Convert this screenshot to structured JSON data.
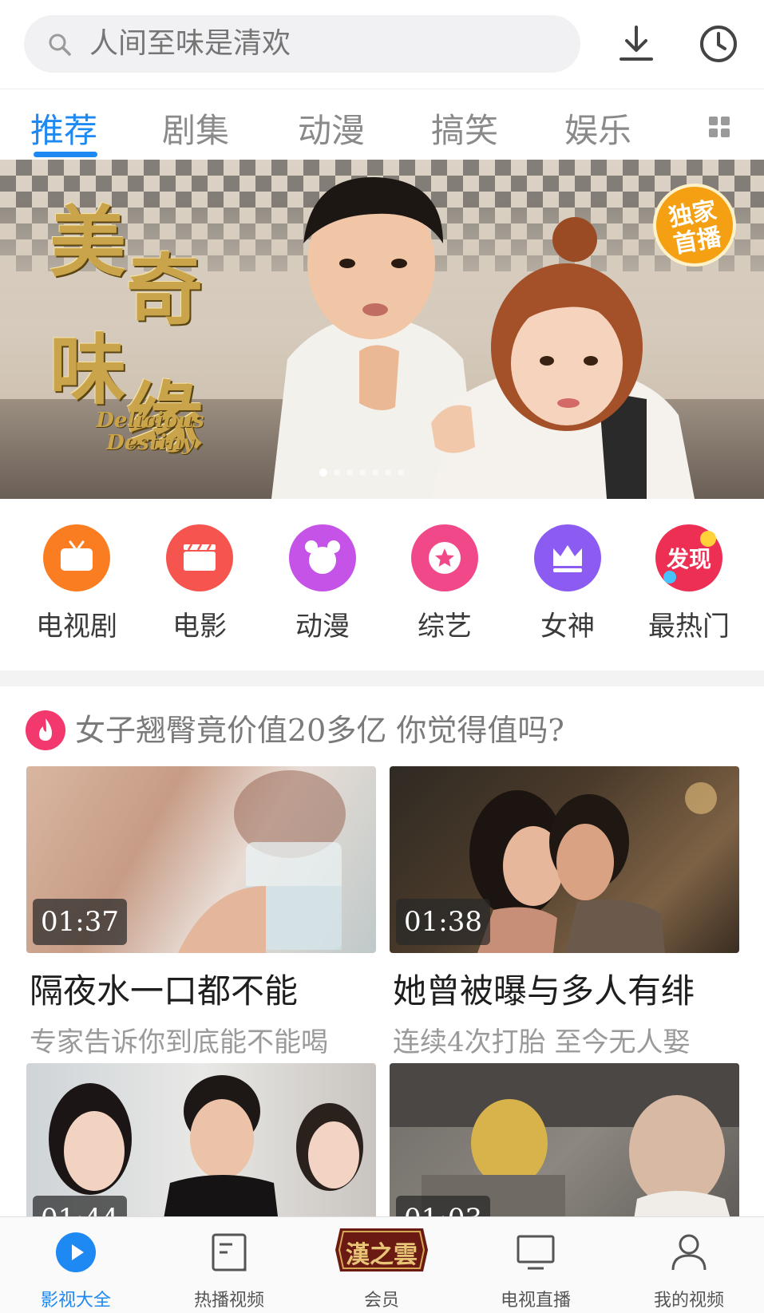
{
  "search": {
    "placeholder": "人间至味是清欢"
  },
  "tabs": [
    {
      "label": "推荐"
    },
    {
      "label": "剧集"
    },
    {
      "label": "动漫"
    },
    {
      "label": "搞笑"
    },
    {
      "label": "娱乐"
    }
  ],
  "banner": {
    "title_chars": [
      "美",
      "奇",
      "味",
      "缘"
    ],
    "subtitle_line1": "Delicious",
    "subtitle_line2": "Destiny",
    "badge_line1": "独家",
    "badge_line2": "首播",
    "slide_count": 7,
    "active_slide": 0
  },
  "categories": [
    {
      "label": "电视剧",
      "color": "#fb7d22"
    },
    {
      "label": "电影",
      "color": "#f6554f"
    },
    {
      "label": "动漫",
      "color": "#c653e8"
    },
    {
      "label": "综艺",
      "color": "#f1488a"
    },
    {
      "label": "女神",
      "color": "#8c5cf2"
    },
    {
      "label": "最热门",
      "icon_text": "发现",
      "color": "#ee2f54"
    }
  ],
  "topic": {
    "text": "女子翘臀竟价值20多亿 你觉得值吗?"
  },
  "videos": [
    {
      "duration": "01:37",
      "title": "隔夜水一口都不能",
      "subtitle": "专家告诉你到底能不能喝"
    },
    {
      "duration": "01:38",
      "title": "她曾被曝与多人有绯",
      "subtitle": "连续4次打胎 至今无人娶"
    },
    {
      "duration": "01:44",
      "title": "",
      "subtitle": ""
    },
    {
      "duration": "01:03",
      "title": "",
      "subtitle": ""
    }
  ],
  "bottom_nav": [
    {
      "label": "影视大全",
      "icon": "play-circle-icon",
      "active": true
    },
    {
      "label": "热播视频",
      "icon": "document-icon"
    },
    {
      "label": "会员",
      "icon": "vip-logo-icon",
      "logo_text": "漢之雲"
    },
    {
      "label": "电视直播",
      "icon": "tv-icon"
    },
    {
      "label": "我的视频",
      "icon": "person-icon"
    }
  ],
  "colors": {
    "accent": "#1e88f3",
    "badge": "#f5a012",
    "topic_fire": "#f2386c"
  }
}
